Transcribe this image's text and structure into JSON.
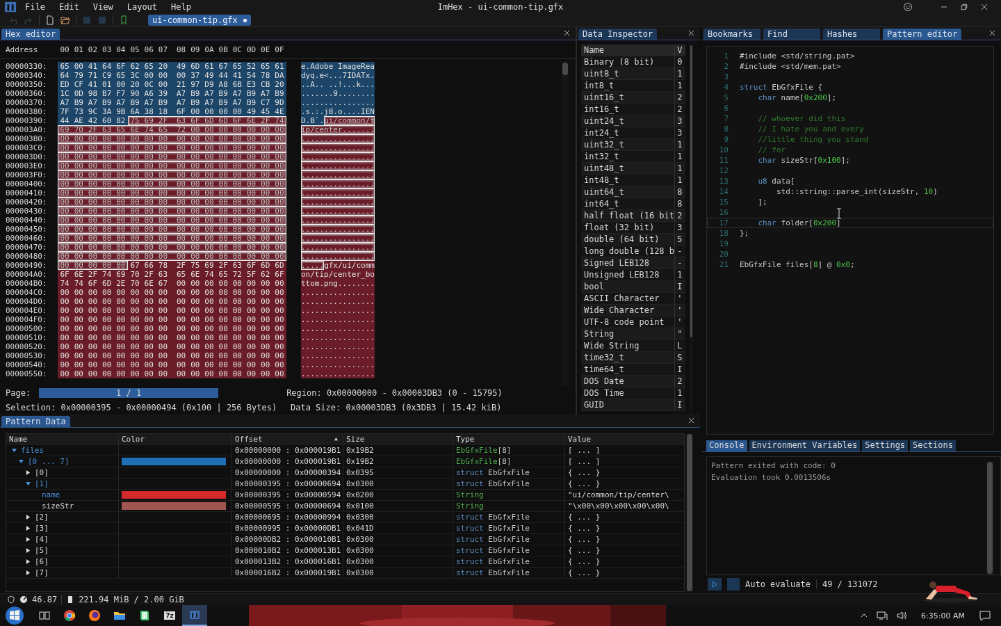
{
  "window": {
    "title": "ImHex - ui-common-tip.gfx"
  },
  "menu": [
    "File",
    "Edit",
    "View",
    "Layout",
    "Help"
  ],
  "toolbar": [
    {
      "kind": "undo",
      "disabled": true
    },
    {
      "kind": "redo",
      "disabled": true
    },
    {
      "kind": "new",
      "disabled": false
    },
    {
      "kind": "open",
      "disabled": false
    },
    {
      "kind": "save",
      "disabled": true
    },
    {
      "kind": "save-as",
      "disabled": true
    },
    {
      "kind": "bookmark",
      "disabled": false
    }
  ],
  "file_tab": {
    "label": "ui-common-tip.gfx",
    "modified": true
  },
  "hex": {
    "title": "Hex editor",
    "address_label": "Address",
    "columns": [
      "00",
      "01",
      "02",
      "03",
      "04",
      "05",
      "06",
      "07",
      "08",
      "09",
      "0A",
      "0B",
      "0C",
      "0D",
      "0E",
      "0F"
    ],
    "rows": [
      {
        "address": "00000330:",
        "segments": [
          {
            "color": "#1c4568",
            "selected": false,
            "bytes": "65 00 41 64 6F 62 65 20 49 6D 61 67 65 52 65 61",
            "ascii": "e.Adobe ImageRea"
          }
        ]
      },
      {
        "address": "00000340:",
        "segments": [
          {
            "color": "#1c4568",
            "selected": false,
            "bytes": "64 79 71 C9 65 3C 00 00 00 37 49 44 41 54 78 DA",
            "ascii": "dyq.e<...7IDATx."
          }
        ]
      },
      {
        "address": "00000350:",
        "segments": [
          {
            "color": "#1c4568",
            "selected": false,
            "bytes": "ED CF 41 01 00 20 0C 00 21 97 D9 A8 6B E3 CB 20",
            "ascii": "..A.. ..!...k..."
          }
        ]
      },
      {
        "address": "00000360:",
        "segments": [
          {
            "color": "#1c4568",
            "selected": false,
            "bytes": "1C 0D 98 B7 F7 90 A6 39 A7 B9 A7 B9 A7 B9 A7 B9",
            "ascii": ".......9........"
          }
        ]
      },
      {
        "address": "00000370:",
        "segments": [
          {
            "color": "#1c4568",
            "selected": false,
            "bytes": "A7 B9 A7 B9 A7 B9 A7 B9 A7 B9 A7 B9 A7 B9 C7 9D",
            "ascii": "................"
          }
        ]
      },
      {
        "address": "00000380:",
        "segments": [
          {
            "color": "#1c4568",
            "selected": false,
            "bytes": "7F 73 9C 3A 9B 6A 38 18 6F 00 00 00 00 49 45 4E",
            "ascii": ".s.:.j8.o....IEN"
          }
        ]
      },
      {
        "address": "00000390:",
        "segments": [
          {
            "color": "#1c4568",
            "selected": false,
            "bytes": "44 AE 42 60 82",
            "ascii": "D.B`."
          },
          {
            "color": "#6a1d28",
            "selected": true,
            "bytes": "75 69 2F 63 6F 6D 6D 6F 6E 2F 74",
            "ascii": "ui/common/t"
          }
        ]
      },
      {
        "address": "000003A0:",
        "segments": [
          {
            "color": "#6a1d28",
            "selected": true,
            "bytes": "69 70 2F 63 65 6E 74 65 72 00 00 00 00 00 00 00",
            "ascii": "ip/center......."
          }
        ]
      },
      {
        "address": "000003B0:",
        "segments": [
          {
            "color": "#6a1d28",
            "selected": true,
            "bytes": "00 00 00 00 00 00 00 00 00 00 00 00 00 00 00 00",
            "ascii": "................"
          }
        ]
      },
      {
        "address": "000003C0:",
        "segments": [
          {
            "color": "#6a1d28",
            "selected": true,
            "bytes": "00 00 00 00 00 00 00 00 00 00 00 00 00 00 00 00",
            "ascii": "................"
          }
        ]
      },
      {
        "address": "000003D0:",
        "segments": [
          {
            "color": "#6a1d28",
            "selected": true,
            "bytes": "00 00 00 00 00 00 00 00 00 00 00 00 00 00 00 00",
            "ascii": "................"
          }
        ]
      },
      {
        "address": "000003E0:",
        "segments": [
          {
            "color": "#6a1d28",
            "selected": true,
            "bytes": "00 00 00 00 00 00 00 00 00 00 00 00 00 00 00 00",
            "ascii": "................"
          }
        ]
      },
      {
        "address": "000003F0:",
        "segments": [
          {
            "color": "#6a1d28",
            "selected": true,
            "bytes": "00 00 00 00 00 00 00 00 00 00 00 00 00 00 00 00",
            "ascii": "................"
          }
        ]
      },
      {
        "address": "00000400:",
        "segments": [
          {
            "color": "#6a1d28",
            "selected": true,
            "bytes": "00 00 00 00 00 00 00 00 00 00 00 00 00 00 00 00",
            "ascii": "................"
          }
        ]
      },
      {
        "address": "00000410:",
        "segments": [
          {
            "color": "#6a1d28",
            "selected": true,
            "bytes": "00 00 00 00 00 00 00 00 00 00 00 00 00 00 00 00",
            "ascii": "................"
          }
        ]
      },
      {
        "address": "00000420:",
        "segments": [
          {
            "color": "#6a1d28",
            "selected": true,
            "bytes": "00 00 00 00 00 00 00 00 00 00 00 00 00 00 00 00",
            "ascii": "................"
          }
        ]
      },
      {
        "address": "00000430:",
        "segments": [
          {
            "color": "#6a1d28",
            "selected": true,
            "bytes": "00 00 00 00 00 00 00 00 00 00 00 00 00 00 00 00",
            "ascii": "................"
          }
        ]
      },
      {
        "address": "00000440:",
        "segments": [
          {
            "color": "#6a1d28",
            "selected": true,
            "bytes": "00 00 00 00 00 00 00 00 00 00 00 00 00 00 00 00",
            "ascii": "................"
          }
        ]
      },
      {
        "address": "00000450:",
        "segments": [
          {
            "color": "#6a1d28",
            "selected": true,
            "bytes": "00 00 00 00 00 00 00 00 00 00 00 00 00 00 00 00",
            "ascii": "................"
          }
        ]
      },
      {
        "address": "00000460:",
        "segments": [
          {
            "color": "#6a1d28",
            "selected": true,
            "bytes": "00 00 00 00 00 00 00 00 00 00 00 00 00 00 00 00",
            "ascii": "................"
          }
        ]
      },
      {
        "address": "00000470:",
        "segments": [
          {
            "color": "#6a1d28",
            "selected": true,
            "bytes": "00 00 00 00 00 00 00 00 00 00 00 00 00 00 00 00",
            "ascii": "................"
          }
        ]
      },
      {
        "address": "00000480:",
        "segments": [
          {
            "color": "#6a1d28",
            "selected": true,
            "bytes": "00 00 00 00 00 00 00 00 00 00 00 00 00 00 00 00",
            "ascii": "................"
          }
        ]
      },
      {
        "address": "00000490:",
        "segments": [
          {
            "color": "#6a1d28",
            "selected": true,
            "bytes": "00 00 00 00 00",
            "ascii": "....."
          },
          {
            "color": "#6a1d28",
            "selected": false,
            "bytes": "67 66 78 2F 75 69 2F 63 6F 6D 6D",
            "ascii": "gfx/ui/comm"
          }
        ]
      },
      {
        "address": "000004A0:",
        "segments": [
          {
            "color": "#6a1d28",
            "selected": false,
            "bytes": "6F 6E 2F 74 69 70 2F 63 65 6E 74 65 72 5F 62 6F",
            "ascii": "on/tip/center_bo"
          }
        ]
      },
      {
        "address": "000004B0:",
        "segments": [
          {
            "color": "#6a1d28",
            "selected": false,
            "bytes": "74 74 6F 6D 2E 70 6E 67 00 00 00 00 00 00 00 00",
            "ascii": "ttom.png........"
          }
        ]
      },
      {
        "address": "000004C0:",
        "segments": [
          {
            "color": "#6a1d28",
            "selected": false,
            "bytes": "00 00 00 00 00 00 00 00 00 00 00 00 00 00 00 00",
            "ascii": "................"
          }
        ]
      },
      {
        "address": "000004D0:",
        "segments": [
          {
            "color": "#6a1d28",
            "selected": false,
            "bytes": "00 00 00 00 00 00 00 00 00 00 00 00 00 00 00 00",
            "ascii": "................"
          }
        ]
      },
      {
        "address": "000004E0:",
        "segments": [
          {
            "color": "#6a1d28",
            "selected": false,
            "bytes": "00 00 00 00 00 00 00 00 00 00 00 00 00 00 00 00",
            "ascii": "................"
          }
        ]
      },
      {
        "address": "000004F0:",
        "segments": [
          {
            "color": "#6a1d28",
            "selected": false,
            "bytes": "00 00 00 00 00 00 00 00 00 00 00 00 00 00 00 00",
            "ascii": "................"
          }
        ]
      },
      {
        "address": "00000500:",
        "segments": [
          {
            "color": "#6a1d28",
            "selected": false,
            "bytes": "00 00 00 00 00 00 00 00 00 00 00 00 00 00 00 00",
            "ascii": "................"
          }
        ]
      },
      {
        "address": "00000510:",
        "segments": [
          {
            "color": "#6a1d28",
            "selected": false,
            "bytes": "00 00 00 00 00 00 00 00 00 00 00 00 00 00 00 00",
            "ascii": "................"
          }
        ]
      },
      {
        "address": "00000520:",
        "segments": [
          {
            "color": "#6a1d28",
            "selected": false,
            "bytes": "00 00 00 00 00 00 00 00 00 00 00 00 00 00 00 00",
            "ascii": "................"
          }
        ]
      },
      {
        "address": "00000530:",
        "segments": [
          {
            "color": "#6a1d28",
            "selected": false,
            "bytes": "00 00 00 00 00 00 00 00 00 00 00 00 00 00 00 00",
            "ascii": "................"
          }
        ]
      },
      {
        "address": "00000540:",
        "segments": [
          {
            "color": "#6a1d28",
            "selected": false,
            "bytes": "00 00 00 00 00 00 00 00 00 00 00 00 00 00 00 00",
            "ascii": "................"
          }
        ]
      },
      {
        "address": "00000550:",
        "segments": [
          {
            "color": "#6a1d28",
            "selected": false,
            "bytes": "00 00 00 00 00 00 00 00 00 00 00 00 00 00 00 00",
            "ascii": "................"
          }
        ]
      }
    ],
    "page_label": "Page:",
    "page": {
      "text": "1 / 1",
      "level": 1
    },
    "region": "Region: 0x00000000 - 0x00003DB3 (0 - 15795)",
    "selection": "Selection: 0x00000395 - 0x00000494 (0x100 | 256 Bytes)",
    "data_size": "Data Size: 0x00003DB3 (0x3DB3 | 15.42 kiB)"
  },
  "inspector": {
    "title": "Data Inspector",
    "columns": [
      "Name",
      "V"
    ],
    "rows": [
      {
        "name": "Binary (8 bit)",
        "value": "0"
      },
      {
        "name": "uint8_t",
        "value": "1"
      },
      {
        "name": "int8_t",
        "value": "1"
      },
      {
        "name": "uint16_t",
        "value": "2"
      },
      {
        "name": "int16_t",
        "value": "2"
      },
      {
        "name": "uint24_t",
        "value": "3"
      },
      {
        "name": "int24_t",
        "value": "3"
      },
      {
        "name": "uint32_t",
        "value": "1"
      },
      {
        "name": "int32_t",
        "value": "1"
      },
      {
        "name": "uint48_t",
        "value": "1"
      },
      {
        "name": "int48_t",
        "value": "1"
      },
      {
        "name": "uint64_t",
        "value": "8"
      },
      {
        "name": "int64_t",
        "value": "8"
      },
      {
        "name": "half float (16 bit",
        "value": "2"
      },
      {
        "name": "float (32 bit)",
        "value": "3"
      },
      {
        "name": "double (64 bit)",
        "value": "5"
      },
      {
        "name": "long double (128 b",
        "value": "-"
      },
      {
        "name": "Signed LEB128",
        "value": "-"
      },
      {
        "name": "Unsigned LEB128",
        "value": "1"
      },
      {
        "name": "bool",
        "value": "I"
      },
      {
        "name": "ASCII Character",
        "value": "'"
      },
      {
        "name": "Wide Character",
        "value": "'"
      },
      {
        "name": "UTF-8 code point",
        "value": "'"
      },
      {
        "name": "String",
        "value": "\""
      },
      {
        "name": "Wide String",
        "value": "L"
      },
      {
        "name": "time32_t",
        "value": "S"
      },
      {
        "name": "time64_t",
        "value": "I"
      },
      {
        "name": "DOS Date",
        "value": "2"
      },
      {
        "name": "DOS Time",
        "value": "1"
      },
      {
        "name": "GUID",
        "value": "I"
      }
    ]
  },
  "right_tabs": [
    {
      "label": "Bookmarks",
      "selected": false
    },
    {
      "label": "Find",
      "selected": false
    },
    {
      "label": "Hashes",
      "selected": false
    },
    {
      "label": "Pattern editor",
      "selected": true
    }
  ],
  "code": [
    {
      "number": "1",
      "selected": false,
      "tokens": [
        {
          "kind": "plain",
          "text": "#include <std/string.pat>"
        }
      ]
    },
    {
      "number": "2",
      "selected": false,
      "tokens": [
        {
          "kind": "plain",
          "text": "#include <std/mem.pat>"
        }
      ]
    },
    {
      "number": "3",
      "selected": false
    },
    {
      "number": "4",
      "selected": false,
      "tokens": [
        {
          "kind": "keyword",
          "text": "struct"
        },
        {
          "kind": "plain",
          "text": " EbGfxFile {"
        }
      ]
    },
    {
      "number": "5",
      "selected": false,
      "tokens": [
        {
          "kind": "keyword",
          "text": "    char"
        },
        {
          "kind": "plain",
          "text": " name["
        },
        {
          "kind": "number",
          "text": "0x200"
        },
        {
          "kind": "plain",
          "text": "];"
        }
      ]
    },
    {
      "number": "6",
      "selected": false
    },
    {
      "number": "7",
      "selected": false,
      "tokens": [
        {
          "kind": "comment",
          "text": "    // whoever did this"
        }
      ]
    },
    {
      "number": "8",
      "selected": false,
      "tokens": [
        {
          "kind": "comment",
          "text": "    // I hate you and every"
        }
      ]
    },
    {
      "number": "9",
      "selected": false,
      "tokens": [
        {
          "kind": "comment",
          "text": "    //little thing you stand"
        }
      ]
    },
    {
      "number": "10",
      "selected": false,
      "tokens": [
        {
          "kind": "comment",
          "text": "    // for"
        }
      ]
    },
    {
      "number": "11",
      "selected": false,
      "tokens": [
        {
          "kind": "keyword",
          "text": "    char"
        },
        {
          "kind": "plain",
          "text": " sizeStr["
        },
        {
          "kind": "number",
          "text": "0x100"
        },
        {
          "kind": "plain",
          "text": "];"
        }
      ]
    },
    {
      "number": "12",
      "selected": false
    },
    {
      "number": "13",
      "selected": false,
      "tokens": [
        {
          "kind": "keyword",
          "text": "    u8"
        },
        {
          "kind": "plain",
          "text": " data["
        }
      ]
    },
    {
      "number": "14",
      "selected": false,
      "tokens": [
        {
          "kind": "plain",
          "text": "        std::string::parse_int(sizeStr, "
        },
        {
          "kind": "number",
          "text": "10"
        },
        {
          "kind": "plain",
          "text": ")"
        }
      ]
    },
    {
      "number": "15",
      "selected": false,
      "tokens": [
        {
          "kind": "plain",
          "text": "    ];"
        }
      ]
    },
    {
      "number": "16",
      "selected": false
    },
    {
      "number": "17",
      "selected": true,
      "tokens": [
        {
          "kind": "keyword",
          "text": "    char"
        },
        {
          "kind": "plain",
          "text": " folder["
        },
        {
          "kind": "number",
          "text": "0x200"
        },
        {
          "kind": "plain",
          "text": "]"
        }
      ]
    },
    {
      "number": "18",
      "selected": false,
      "tokens": [
        {
          "kind": "plain",
          "text": "};"
        }
      ]
    },
    {
      "number": "19",
      "selected": false
    },
    {
      "number": "20",
      "selected": false
    },
    {
      "number": "21",
      "selected": false,
      "tokens": [
        {
          "kind": "plain",
          "text": "EbGfxFile files["
        },
        {
          "kind": "number",
          "text": "8"
        },
        {
          "kind": "plain",
          "text": "] @ "
        },
        {
          "kind": "number",
          "text": "0x0"
        },
        {
          "kind": "plain",
          "text": ";"
        }
      ]
    }
  ],
  "console_tabs": [
    {
      "label": "Console",
      "selected": true
    },
    {
      "label": "Environment Variables",
      "selected": false
    },
    {
      "label": "Settings",
      "selected": false
    },
    {
      "label": "Sections",
      "selected": false
    }
  ],
  "console_lines": [
    "Pattern exited with code: 0",
    "Evaluation took 0.0013506s"
  ],
  "auto_evaluate": {
    "label": "Auto evaluate",
    "checked": false
  },
  "cursor_position": "49 / 131072",
  "pattern_data": {
    "title": "Pattern Data",
    "columns": [
      {
        "label": "Name",
        "sorted": false
      },
      {
        "label": "Color",
        "sorted": false
      },
      {
        "label": "Offset",
        "sorted": true
      },
      {
        "label": "Size",
        "sorted": false
      },
      {
        "label": "Type",
        "sorted": false
      },
      {
        "label": "Value",
        "sorted": false
      }
    ],
    "rows": [
      {
        "name": "files",
        "highlighted": true,
        "expanded": true,
        "offset": "0x00000000 : 0x000019B1",
        "size": "0x19B2",
        "type": [
          {
            "kind": "type",
            "text": "EbGfxFile"
          },
          {
            "kind": "plain",
            "text": "[8]"
          }
        ],
        "value": "[ ... ]",
        "children": [
          {
            "name": "[0 ... 7]",
            "highlighted": true,
            "expanded": true,
            "color": "#1f6fb4",
            "offset": "0x00000000 : 0x000019B1",
            "size": "0x19B2",
            "type": [
              {
                "kind": "type",
                "text": "EbGfxFile"
              },
              {
                "kind": "plain",
                "text": "[8]"
              }
            ],
            "value": "[ ... ]",
            "children": [
              {
                "name": "[0]",
                "highlighted": false,
                "expanded": false,
                "offset": "0x00000000 : 0x00000394",
                "size": "0x0395",
                "type": [
                  {
                    "kind": "keyword",
                    "text": "struct"
                  },
                  {
                    "kind": "plain",
                    "text": " EbGfxFile"
                  }
                ],
                "value": "{ ... }"
              },
              {
                "name": "[1]",
                "highlighted": true,
                "expanded": true,
                "offset": "0x00000395 : 0x00000694",
                "size": "0x0300",
                "type": [
                  {
                    "kind": "keyword",
                    "text": "struct"
                  },
                  {
                    "kind": "plain",
                    "text": " EbGfxFile"
                  }
                ],
                "value": "{ ... }",
                "children": [
                  {
                    "name": "name",
                    "highlighted": true,
                    "color": "#d42a2a",
                    "offset": "0x00000395 : 0x00000594",
                    "size": "0x0200",
                    "type": [
                      {
                        "kind": "type",
                        "text": "String"
                      }
                    ],
                    "value": "\"ui/common/tip/center\\"
                  },
                  {
                    "name": "sizeStr",
                    "highlighted": false,
                    "color": "#a15550",
                    "offset": "0x00000595 : 0x00000694",
                    "size": "0x0100",
                    "type": [
                      {
                        "kind": "type",
                        "text": "String"
                      }
                    ],
                    "value": "\"\\x00\\x00\\x00\\x00\\x00\\"
                  }
                ]
              },
              {
                "name": "[2]",
                "highlighted": false,
                "expanded": false,
                "offset": "0x00000695 : 0x00000994",
                "size": "0x0300",
                "type": [
                  {
                    "kind": "keyword",
                    "text": "struct"
                  },
                  {
                    "kind": "plain",
                    "text": " EbGfxFile"
                  }
                ],
                "value": "{ ... }"
              },
              {
                "name": "[3]",
                "highlighted": false,
                "expanded": false,
                "offset": "0x00000995 : 0x00000DB1",
                "size": "0x041D",
                "type": [
                  {
                    "kind": "keyword",
                    "text": "struct"
                  },
                  {
                    "kind": "plain",
                    "text": " EbGfxFile"
                  }
                ],
                "value": "{ ... }"
              },
              {
                "name": "[4]",
                "highlighted": false,
                "expanded": false,
                "offset": "0x00000DB2 : 0x000010B1",
                "size": "0x0300",
                "type": [
                  {
                    "kind": "keyword",
                    "text": "struct"
                  },
                  {
                    "kind": "plain",
                    "text": " EbGfxFile"
                  }
                ],
                "value": "{ ... }"
              },
              {
                "name": "[5]",
                "highlighted": false,
                "expanded": false,
                "offset": "0x000010B2 : 0x000013B1",
                "size": "0x0300",
                "type": [
                  {
                    "kind": "keyword",
                    "text": "struct"
                  },
                  {
                    "kind": "plain",
                    "text": " EbGfxFile"
                  }
                ],
                "value": "{ ... }"
              },
              {
                "name": "[6]",
                "highlighted": false,
                "expanded": false,
                "offset": "0x000013B2 : 0x000016B1",
                "size": "0x0300",
                "type": [
                  {
                    "kind": "keyword",
                    "text": "struct"
                  },
                  {
                    "kind": "plain",
                    "text": " EbGfxFile"
                  }
                ],
                "value": "{ ... }"
              },
              {
                "name": "[7]",
                "highlighted": false,
                "expanded": false,
                "offset": "0x000016B2 : 0x000019B1",
                "size": "0x0300",
                "type": [
                  {
                    "kind": "keyword",
                    "text": "struct"
                  },
                  {
                    "kind": "plain",
                    "text": " EbGfxFile"
                  }
                ],
                "value": "{ ... }"
              }
            ]
          }
        ]
      }
    ]
  },
  "status": {
    "fps": "46.87",
    "memory": "221.94 MiB / 2.00 GiB"
  },
  "taskbar": {
    "apps": [
      {
        "kind": "task-view",
        "selected": false
      },
      {
        "kind": "chrome",
        "selected": false
      },
      {
        "kind": "firefox",
        "selected": false
      },
      {
        "kind": "folder",
        "selected": false
      },
      {
        "kind": "book",
        "selected": false
      },
      {
        "kind": "archive",
        "label": "7z",
        "selected": false
      },
      {
        "kind": "imhex",
        "selected": true
      }
    ],
    "time": "6:35:00 AM"
  }
}
